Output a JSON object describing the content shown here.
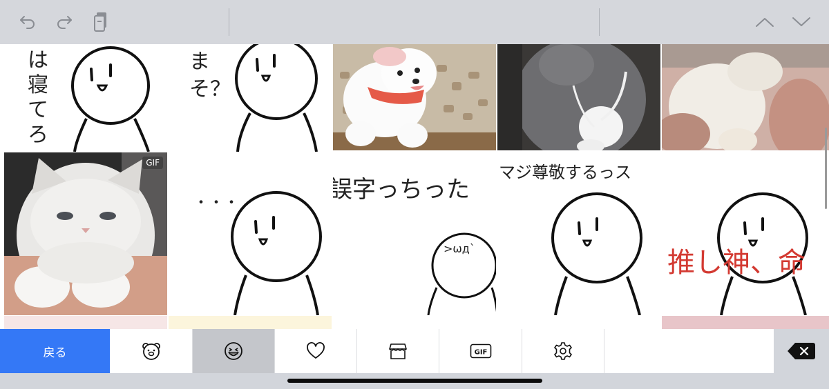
{
  "toolbar": {
    "undo_icon": "undo-icon",
    "redo_icon": "redo-icon",
    "clipboard_icon": "clipboard-icon",
    "up_icon": "chevron-up-icon",
    "down_icon": "chevron-down-icon"
  },
  "stickers": [
    {
      "id": "sticker-1",
      "text": "は寝てろ"
    },
    {
      "id": "sticker-2",
      "text": "まそ？"
    },
    {
      "id": "sticker-3",
      "text": ""
    },
    {
      "id": "sticker-4",
      "text": ""
    },
    {
      "id": "sticker-5",
      "text": ""
    },
    {
      "id": "sticker-6",
      "text": "",
      "badge": "GIF"
    },
    {
      "id": "sticker-7",
      "text": "・・・"
    },
    {
      "id": "sticker-8",
      "text": "誤字っちった",
      "face": "´>ωд`"
    },
    {
      "id": "sticker-9",
      "text": "マジ尊敬するっス"
    },
    {
      "id": "sticker-10",
      "text": "推し神、命"
    }
  ],
  "tabbar": {
    "back_label": "戻る",
    "tabs": [
      {
        "icon": "bear-face-icon",
        "active": false
      },
      {
        "icon": "grinning-face-icon",
        "active": true
      },
      {
        "icon": "heart-icon",
        "active": false
      },
      {
        "icon": "store-icon",
        "active": false
      },
      {
        "icon": "gif-icon",
        "label": "GIF",
        "active": false
      },
      {
        "icon": "gear-icon",
        "active": false
      }
    ],
    "delete_icon": "delete-backspace-icon"
  },
  "colors": {
    "accent": "#3478f6",
    "keyboard_bg": "#d2d5db",
    "active_tab": "#c4c6cb",
    "red_text": "#d33a32"
  }
}
